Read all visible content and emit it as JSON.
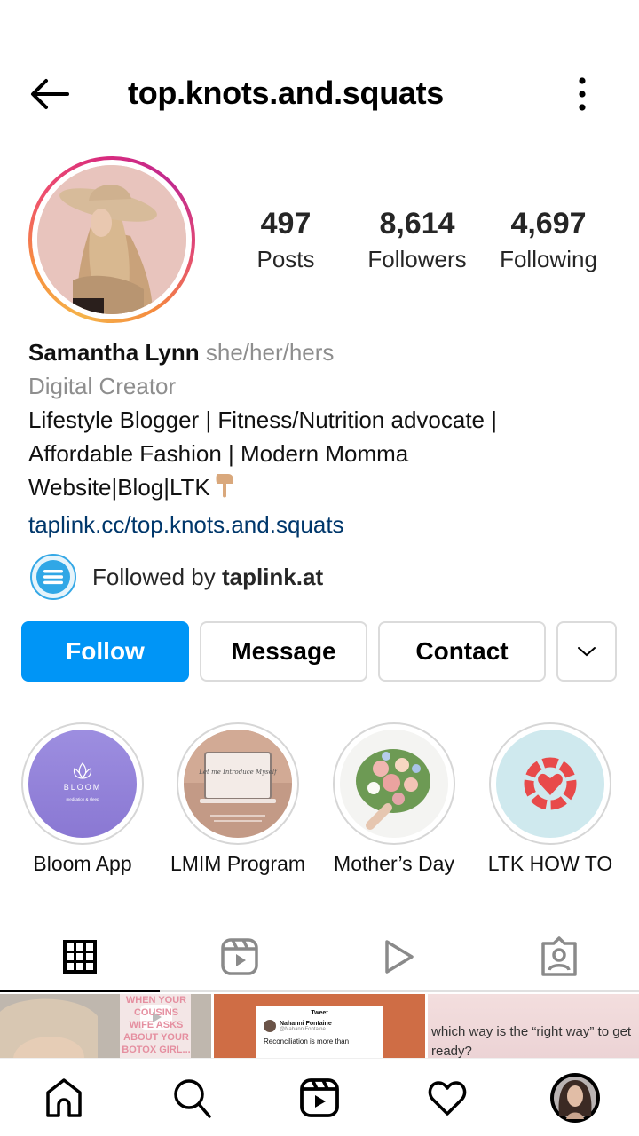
{
  "header": {
    "username": "top.knots.and.squats",
    "back_icon": "arrow-left-icon",
    "more_icon": "vertical-dots-icon"
  },
  "profile": {
    "stats": [
      {
        "value": "497",
        "label": "Posts"
      },
      {
        "value": "8,614",
        "label": "Followers"
      },
      {
        "value": "4,697",
        "label": "Following"
      }
    ],
    "name": "Samantha Lynn",
    "pronouns": "she/her/hers",
    "category": "Digital Creator",
    "bio_lines": [
      "Lifestyle Blogger | Fitness/Nutrition advocate |",
      "Affordable Fashion | Modern Momma",
      "Website|Blog|LTK"
    ],
    "bio_emoji": "👇🏼",
    "link": "taplink.cc/top.knots.and.squats",
    "followed_by_prefix": "Followed by ",
    "followed_by_user": "taplink.at"
  },
  "actions": {
    "follow": "Follow",
    "message": "Message",
    "contact": "Contact",
    "more_icon": "chevron-down-icon"
  },
  "highlights": [
    {
      "label": "Bloom App",
      "image_text": "BLOOM",
      "image_subtext": "meditation & sleep"
    },
    {
      "label": "LMIM Program",
      "image_text": "Let me Introduce Myself"
    },
    {
      "label": "Mother’s Day"
    },
    {
      "label": "LTK HOW TO"
    }
  ],
  "tabs": [
    {
      "name": "posts-grid",
      "icon": "grid-icon",
      "active": true
    },
    {
      "name": "reels",
      "icon": "reels-icon",
      "active": false
    },
    {
      "name": "videos",
      "icon": "play-icon",
      "active": false
    },
    {
      "name": "tagged",
      "icon": "tagged-person-icon",
      "active": false
    }
  ],
  "posts": [
    {
      "text": "WHEN YOUR COUSINS WIFE ASKS ABOUT YOUR BOTOX GIRL..."
    },
    {
      "text": "Tweet",
      "tweet_name": "Nahanni Fontaine",
      "tweet_handle": "@NahanniFontaine",
      "tweet_body": "Reconciliation is more than"
    },
    {
      "text": "which way is the “right way” to get ready?"
    }
  ],
  "bottom_nav": [
    {
      "name": "home",
      "icon": "home-icon"
    },
    {
      "name": "search",
      "icon": "search-icon"
    },
    {
      "name": "reels",
      "icon": "reels-icon"
    },
    {
      "name": "activity",
      "icon": "heart-icon"
    },
    {
      "name": "profile",
      "icon": "profile-avatar"
    }
  ],
  "colors": {
    "accent": "#0095f6",
    "link": "#00376b",
    "muted": "#8e8e8e"
  }
}
